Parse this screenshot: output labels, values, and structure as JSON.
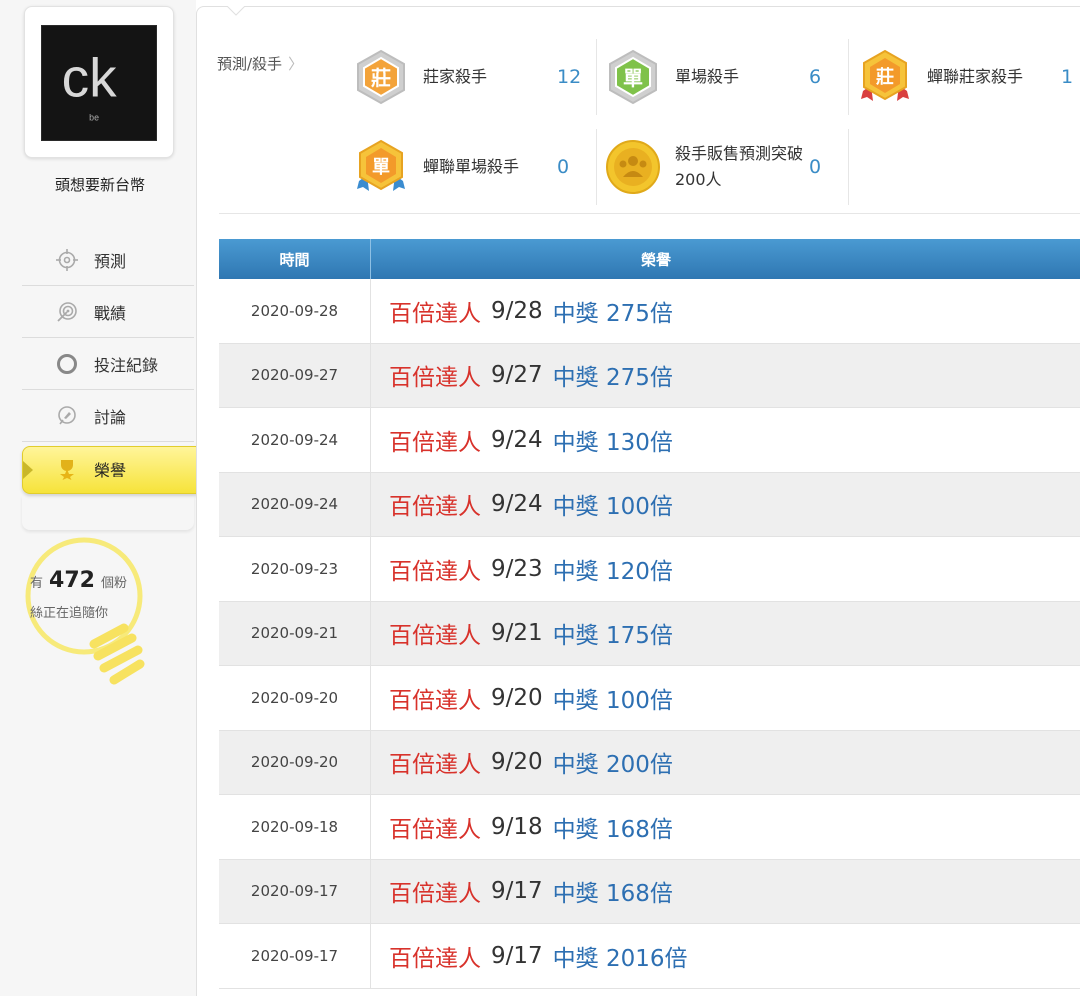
{
  "user": {
    "name": "頭想要新台幣",
    "avatar_text": "ck",
    "avatar_subtext": "be"
  },
  "sidebar": {
    "items": [
      {
        "label": "預測",
        "icon": "crosshair-icon"
      },
      {
        "label": "戰績",
        "icon": "target-icon"
      },
      {
        "label": "投注紀錄",
        "icon": "circle-icon"
      },
      {
        "label": "討論",
        "icon": "chat-icon"
      },
      {
        "label": "榮譽",
        "icon": "trophy-icon",
        "active": true
      }
    ]
  },
  "fans": {
    "prefix": "有",
    "count": "472",
    "suffix": "個粉",
    "line2": "絲正在追隨你"
  },
  "breadcrumb": {
    "label": "預測/殺手",
    "chevron": "〉"
  },
  "badges": [
    {
      "name": "莊家殺手",
      "count": "12",
      "glyph": "莊",
      "icon": "banker-killer-badge-icon"
    },
    {
      "name": "單場殺手",
      "count": "6",
      "glyph": "單",
      "icon": "single-killer-badge-icon"
    },
    {
      "name": "蟬聯莊家殺手",
      "count": "1",
      "glyph": "莊",
      "icon": "consecutive-banker-killer-badge-icon"
    },
    {
      "name": "蟬聯單場殺手",
      "count": "0",
      "glyph": "單",
      "icon": "consecutive-single-killer-badge-icon"
    },
    {
      "name": "殺手販售預測突破200人",
      "count": "0",
      "icon": "people-medal-icon"
    }
  ],
  "table": {
    "headers": {
      "time": "時間",
      "honor": "榮譽"
    },
    "rows": [
      {
        "date": "2020-09-28",
        "title": "百倍達人",
        "day": "9/28",
        "result": "中獎 275倍"
      },
      {
        "date": "2020-09-27",
        "title": "百倍達人",
        "day": "9/27",
        "result": "中獎 275倍"
      },
      {
        "date": "2020-09-24",
        "title": "百倍達人",
        "day": "9/24",
        "result": "中獎 130倍"
      },
      {
        "date": "2020-09-24",
        "title": "百倍達人",
        "day": "9/24",
        "result": "中獎 100倍"
      },
      {
        "date": "2020-09-23",
        "title": "百倍達人",
        "day": "9/23",
        "result": "中獎 120倍"
      },
      {
        "date": "2020-09-21",
        "title": "百倍達人",
        "day": "9/21",
        "result": "中獎 175倍"
      },
      {
        "date": "2020-09-20",
        "title": "百倍達人",
        "day": "9/20",
        "result": "中獎 100倍"
      },
      {
        "date": "2020-09-20",
        "title": "百倍達人",
        "day": "9/20",
        "result": "中獎 200倍"
      },
      {
        "date": "2020-09-18",
        "title": "百倍達人",
        "day": "9/18",
        "result": "中獎 168倍"
      },
      {
        "date": "2020-09-17",
        "title": "百倍達人",
        "day": "9/17",
        "result": "中獎 168倍"
      },
      {
        "date": "2020-09-17",
        "title": "百倍達人",
        "day": "9/17",
        "result": "中獎 2016倍"
      }
    ]
  },
  "colors": {
    "accent_blue": "#3a8cc6",
    "header_blue": "#2f77b2",
    "title_red": "#d8322b",
    "result_blue": "#2d6fb2",
    "active_yellow": "#f6e33a"
  }
}
